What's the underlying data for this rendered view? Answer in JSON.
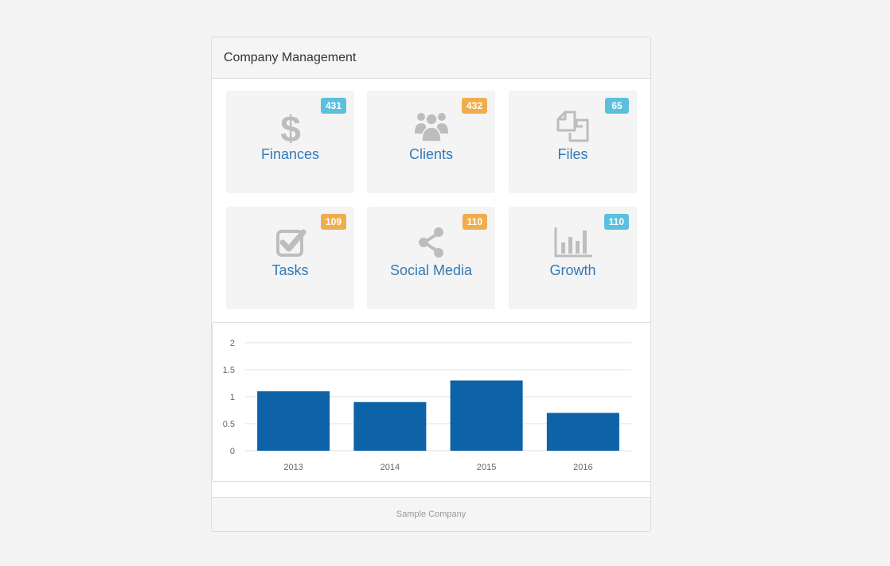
{
  "panel": {
    "title": "Company Management",
    "footer": "Sample Company"
  },
  "tiles": [
    {
      "label": "Finances",
      "badge": "431",
      "badge_style": "info",
      "icon": "dollar-icon"
    },
    {
      "label": "Clients",
      "badge": "432",
      "badge_style": "warning",
      "icon": "users-icon"
    },
    {
      "label": "Files",
      "badge": "65",
      "badge_style": "info",
      "icon": "files-icon"
    },
    {
      "label": "Tasks",
      "badge": "109",
      "badge_style": "warning",
      "icon": "checkbox-icon"
    },
    {
      "label": "Social Media",
      "badge": "110",
      "badge_style": "warning",
      "icon": "share-icon"
    },
    {
      "label": "Growth",
      "badge": "110",
      "badge_style": "info",
      "icon": "bar-chart-icon"
    }
  ],
  "colors": {
    "page_background": "#f4f4f4",
    "link": "#337ab7",
    "icon": "#bdbdbd",
    "badge_info": "#5bc0de",
    "badge_warning": "#f0ad4e",
    "bar": "#0d62a8",
    "grid": "#e2e2e2"
  },
  "chart_data": {
    "type": "bar",
    "categories": [
      "2013",
      "2014",
      "2015",
      "2016"
    ],
    "values": [
      1.1,
      0.9,
      1.3,
      0.7
    ],
    "ylim": [
      0,
      2
    ],
    "yticks": [
      "0",
      "0.5",
      "1",
      "1.5",
      "2"
    ],
    "grid": true,
    "title": "",
    "xlabel": "",
    "ylabel": ""
  }
}
